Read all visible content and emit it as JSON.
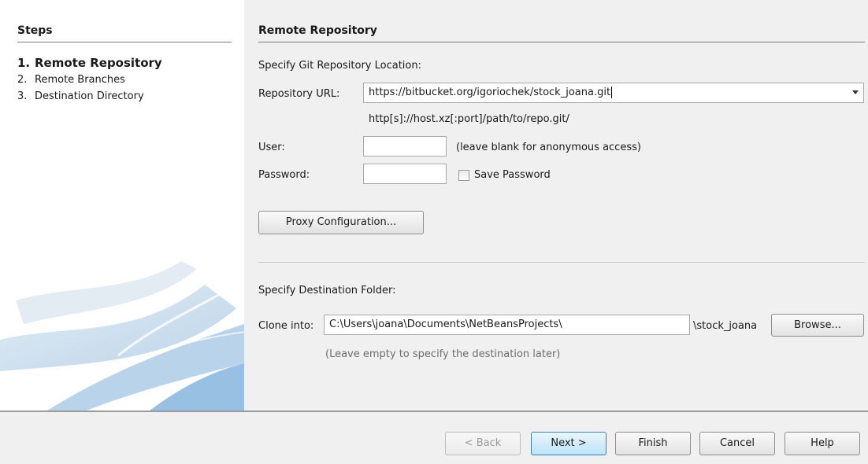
{
  "steps": {
    "title": "Steps",
    "items": [
      {
        "num": "1.",
        "label": "Remote Repository"
      },
      {
        "num": "2.",
        "label": "Remote Branches"
      },
      {
        "num": "3.",
        "label": "Destination Directory"
      }
    ]
  },
  "panel": {
    "title": "Remote Repository",
    "specify_location": "Specify Git Repository Location:",
    "repo_url_label": "Repository URL:",
    "repo_url_value": "https://bitbucket.org/igoriochek/stock_joana.git",
    "url_hint": "http[s]://host.xz[:port]/path/to/repo.git/",
    "user_label": "User:",
    "user_value": "",
    "user_hint": "(leave blank for anonymous access)",
    "password_label": "Password:",
    "password_value": "",
    "save_password_label": "Save Password",
    "save_password_checked": false,
    "proxy_button": "Proxy Configuration...",
    "specify_destination": "Specify Destination Folder:",
    "clone_into_label": "Clone into:",
    "clone_into_value": "C:\\Users\\joana\\Documents\\NetBeansProjects\\",
    "clone_suffix": "\\stock_joana",
    "browse_button": "Browse...",
    "destination_hint": "(Leave empty to specify the destination later)"
  },
  "footer": {
    "back": "< Back",
    "next": "Next >",
    "finish": "Finish",
    "cancel": "Cancel",
    "help": "Help"
  }
}
